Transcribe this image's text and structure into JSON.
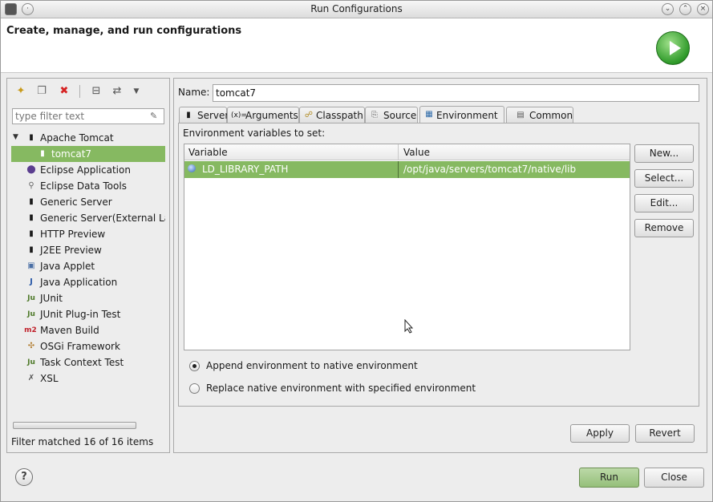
{
  "window": {
    "title": "Run Configurations"
  },
  "header": {
    "title": "Create, manage, and run configurations"
  },
  "left": {
    "filter_placeholder": "type filter text",
    "tree": [
      {
        "label": "Apache Tomcat",
        "icon": "server-icon",
        "expanded": true,
        "level": 0
      },
      {
        "label": "tomcat7",
        "icon": "server-icon",
        "level": 1,
        "selected": true
      },
      {
        "label": "Eclipse Application",
        "icon": "eclipse-icon",
        "level": 0
      },
      {
        "label": "Eclipse Data Tools",
        "icon": "database-icon",
        "level": 0
      },
      {
        "label": "Generic Server",
        "icon": "server-icon",
        "level": 0
      },
      {
        "label": "Generic Server(External Lau",
        "icon": "server-icon",
        "level": 0
      },
      {
        "label": "HTTP Preview",
        "icon": "server-icon",
        "level": 0
      },
      {
        "label": "J2EE Preview",
        "icon": "server-icon",
        "level": 0
      },
      {
        "label": "Java Applet",
        "icon": "applet-icon",
        "level": 0
      },
      {
        "label": "Java Application",
        "icon": "java-app-icon",
        "level": 0
      },
      {
        "label": "JUnit",
        "icon": "junit-icon",
        "level": 0
      },
      {
        "label": "JUnit Plug-in Test",
        "icon": "junit-plugin-icon",
        "level": 0
      },
      {
        "label": "Maven Build",
        "icon": "maven-icon",
        "level": 0
      },
      {
        "label": "OSGi Framework",
        "icon": "osgi-icon",
        "level": 0
      },
      {
        "label": "Task Context Test",
        "icon": "junit-icon",
        "level": 0
      },
      {
        "label": "XSL",
        "icon": "xsl-icon",
        "level": 0
      }
    ],
    "status": "Filter matched 16 of 16 items"
  },
  "right": {
    "name_label": "Name:",
    "name_value": "tomcat7",
    "tabs": [
      {
        "label": "Server",
        "icon": "server-icon"
      },
      {
        "label": "Arguments",
        "icon": "arguments-icon"
      },
      {
        "label": "Classpath",
        "icon": "classpath-icon"
      },
      {
        "label": "Source",
        "icon": "source-icon"
      },
      {
        "label": "Environment",
        "icon": "environment-icon",
        "active": true
      },
      {
        "label": "Common",
        "icon": "common-icon"
      }
    ],
    "env_label": "Environment variables to set:",
    "table": {
      "columns": [
        "Variable",
        "Value"
      ],
      "rows": [
        {
          "variable": "LD_LIBRARY_PATH",
          "value": "/opt/java/servers/tomcat7/native/lib"
        }
      ]
    },
    "side_buttons": [
      "New...",
      "Select...",
      "Edit...",
      "Remove"
    ],
    "radio": {
      "append": "Append environment to native environment",
      "replace": "Replace native environment with specified environment",
      "selected": "append"
    },
    "apply": "Apply",
    "revert": "Revert"
  },
  "footer": {
    "run": "Run",
    "close": "Close",
    "help": "?"
  },
  "colors": {
    "selection": "#86b961",
    "run_accent": "#2f9a2a"
  }
}
